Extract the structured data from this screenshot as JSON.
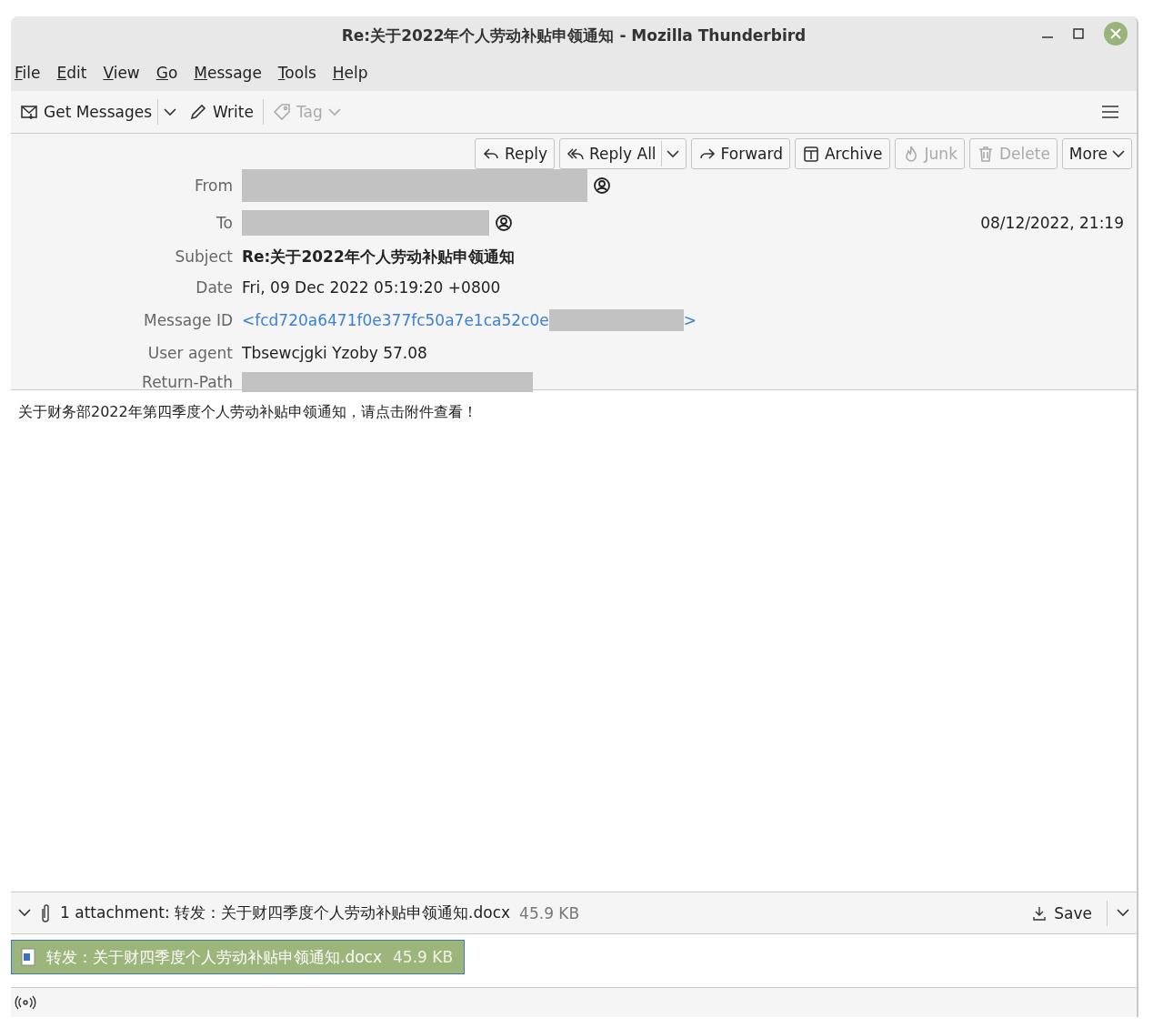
{
  "window": {
    "title": "Re:关于2022年个人劳动补贴申领通知 - Mozilla Thunderbird"
  },
  "menu": [
    {
      "label": "File"
    },
    {
      "label": "Edit"
    },
    {
      "label": "View"
    },
    {
      "label": "Go"
    },
    {
      "label": "Message"
    },
    {
      "label": "Tools"
    },
    {
      "label": "Help"
    }
  ],
  "toolbar": [
    {
      "kind": "split",
      "label": "Get Messages",
      "disabled": false
    },
    {
      "kind": "plain",
      "label": "Write",
      "disabled": false
    },
    {
      "kind": "dropdown",
      "label": "Tag",
      "disabled": true
    }
  ],
  "actions": [
    {
      "kind": "plain",
      "label": "Reply",
      "disabled": false
    },
    {
      "kind": "split",
      "label": "Reply All",
      "disabled": false
    },
    {
      "kind": "plain",
      "label": "Forward",
      "disabled": false
    },
    {
      "kind": "plain",
      "label": "Archive",
      "disabled": false
    },
    {
      "kind": "plain",
      "label": "Junk",
      "disabled": true
    },
    {
      "kind": "plain",
      "label": "Delete",
      "disabled": true
    },
    {
      "kind": "dropdown",
      "label": "More",
      "disabled": false
    }
  ],
  "headers": [
    {
      "label": "From",
      "kind": "contact",
      "redacted": true
    },
    {
      "label": "To",
      "kind": "contact",
      "redacted": true,
      "time": "08/12/2022, 21:19"
    },
    {
      "label": "Subject",
      "kind": "bold",
      "value": "Re:关于2022年个人劳动补贴申领通知"
    },
    {
      "label": "Date",
      "kind": "text",
      "value": "Fri, 09 Dec 2022 05:19:20 +0800"
    },
    {
      "label": "Message ID",
      "kind": "link",
      "value": "<fcd720a6471f0e377fc50a7e1ca52c0e",
      "redacted": true,
      "suffix": ">"
    },
    {
      "label": "User agent",
      "kind": "text",
      "value": "Tbsewcjgki Yzoby 57.08"
    },
    {
      "label": "Return-Path",
      "kind": "text",
      "redacted": true
    }
  ],
  "body": "关于财务部2022年第四季度个人劳动补贴申领通知，请点击附件查看！",
  "attachment_bar": {
    "expanded": true,
    "summary": "1 attachment: 转发：关于财四季度个人劳动补贴申领通知.docx",
    "size": "45.9 KB",
    "save": "Save"
  },
  "attachments": [
    {
      "name": "转发：关于财四季度个人劳动补贴申领通知.docx",
      "size": "45.9 KB",
      "selected": true
    }
  ]
}
